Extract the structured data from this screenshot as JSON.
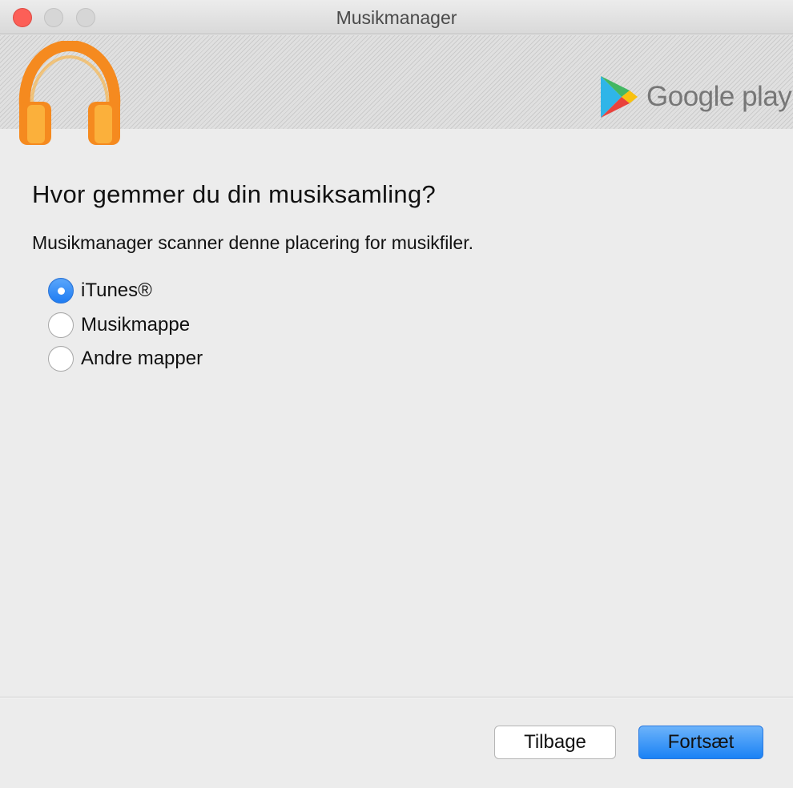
{
  "window": {
    "title": "Musikmanager"
  },
  "banner": {
    "brand_text": "Google play",
    "app_icon": "headphones-icon",
    "brand_icon": "google-play-triangle-icon"
  },
  "content": {
    "heading": "Hvor gemmer du din musiksamling?",
    "description": "Musikmanager scanner denne placering for musikfiler.",
    "options": [
      {
        "label": "iTunes®",
        "selected": true
      },
      {
        "label": "Musikmappe",
        "selected": false
      },
      {
        "label": "Andre mapper",
        "selected": false
      }
    ]
  },
  "footer": {
    "back_label": "Tilbage",
    "continue_label": "Fortsæt"
  },
  "colors": {
    "accent": "#1e7cf2",
    "close_button": "#fc5f57",
    "headphones_orange": "#f58a1f"
  }
}
